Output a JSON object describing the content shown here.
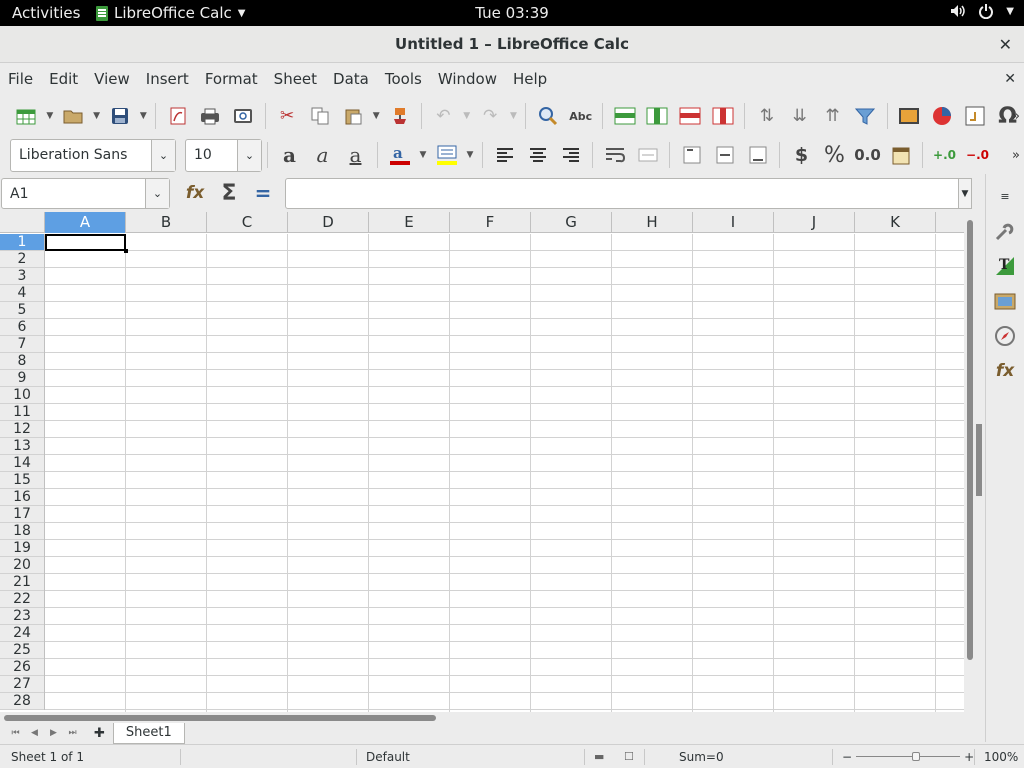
{
  "system": {
    "activities": "Activities",
    "app_name": "LibreOffice Calc",
    "clock": "Tue 03:39",
    "icons": [
      "volume-icon",
      "power-icon"
    ]
  },
  "window": {
    "title": "Untitled 1 – LibreOffice Calc"
  },
  "menu": {
    "items": [
      "File",
      "Edit",
      "View",
      "Insert",
      "Format",
      "Sheet",
      "Data",
      "Tools",
      "Window",
      "Help"
    ]
  },
  "format": {
    "font_name": "Liberation Sans",
    "font_size": "10",
    "currency": "$",
    "percent": "%",
    "number": "0.0"
  },
  "formula_bar": {
    "name_box": "A1",
    "content": ""
  },
  "columns": [
    "A",
    "B",
    "C",
    "D",
    "E",
    "F",
    "G",
    "H",
    "I",
    "J",
    "K"
  ],
  "rows": [
    "1",
    "2",
    "3",
    "4",
    "5",
    "6",
    "7",
    "8",
    "9",
    "10",
    "11",
    "12",
    "13",
    "14",
    "15",
    "16",
    "17",
    "18",
    "19",
    "20",
    "21",
    "22",
    "23",
    "24",
    "25",
    "26",
    "27",
    "28"
  ],
  "selection": {
    "cell": "A1",
    "column": "A",
    "row": "1"
  },
  "sheets": {
    "tabs": [
      "Sheet1"
    ],
    "active": "Sheet1"
  },
  "status": {
    "sheet_info": "Sheet 1 of 1",
    "page_style": "Default",
    "sum": "Sum=0",
    "zoom": "100%",
    "zoom_minus": "−",
    "zoom_plus": "+"
  },
  "colors": {
    "selection_header": "#5e9fe3",
    "topbar": "#000000"
  }
}
